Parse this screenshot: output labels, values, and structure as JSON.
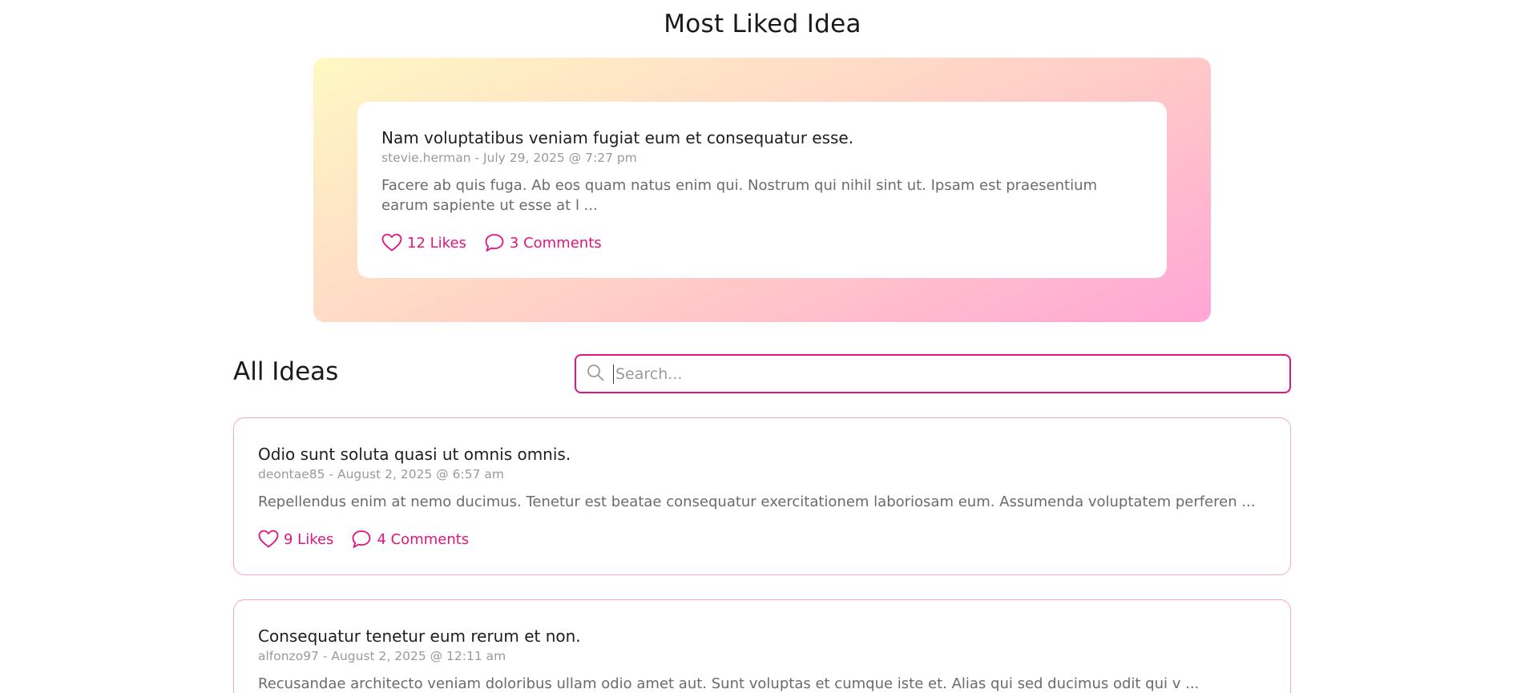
{
  "featured": {
    "heading": "Most Liked Idea",
    "title": "Nam voluptatibus veniam fugiat eum et consequatur esse.",
    "meta": "stevie.herman - July 29, 2025 @ 7:27 pm",
    "body": "Facere ab quis fuga. Ab eos quam natus enim qui. Nostrum qui nihil sint ut. Ipsam est praesentium earum sapiente ut esse at l ...",
    "likes": "12 Likes",
    "comments": "3 Comments"
  },
  "all_ideas": {
    "heading": "All Ideas",
    "search_placeholder": "Search...",
    "items": [
      {
        "title": "Odio sunt soluta quasi ut omnis omnis.",
        "meta": "deontae85 - August 2, 2025 @ 6:57 am",
        "body": "Repellendus enim at nemo ducimus. Tenetur est beatae consequatur exercitationem laboriosam eum. Assumenda voluptatem perferen ...",
        "likes": "9 Likes",
        "comments": "4 Comments"
      },
      {
        "title": "Consequatur tenetur eum rerum et non.",
        "meta": "alfonzo97 - August 2, 2025 @ 12:11 am",
        "body": "Recusandae architecto veniam doloribus ullam odio amet aut. Sunt voluptas et cumque iste et. Alias qui sed ducimus odit qui v ..."
      }
    ]
  },
  "icons": {
    "like": "heart-icon",
    "comment": "speech-bubble-icon",
    "search": "search-icon"
  },
  "colors": {
    "accent": "#e0157f",
    "card_border": "#f7a6cf",
    "gradient_start": "#fff8c4",
    "gradient_end": "#ffa6d6"
  }
}
